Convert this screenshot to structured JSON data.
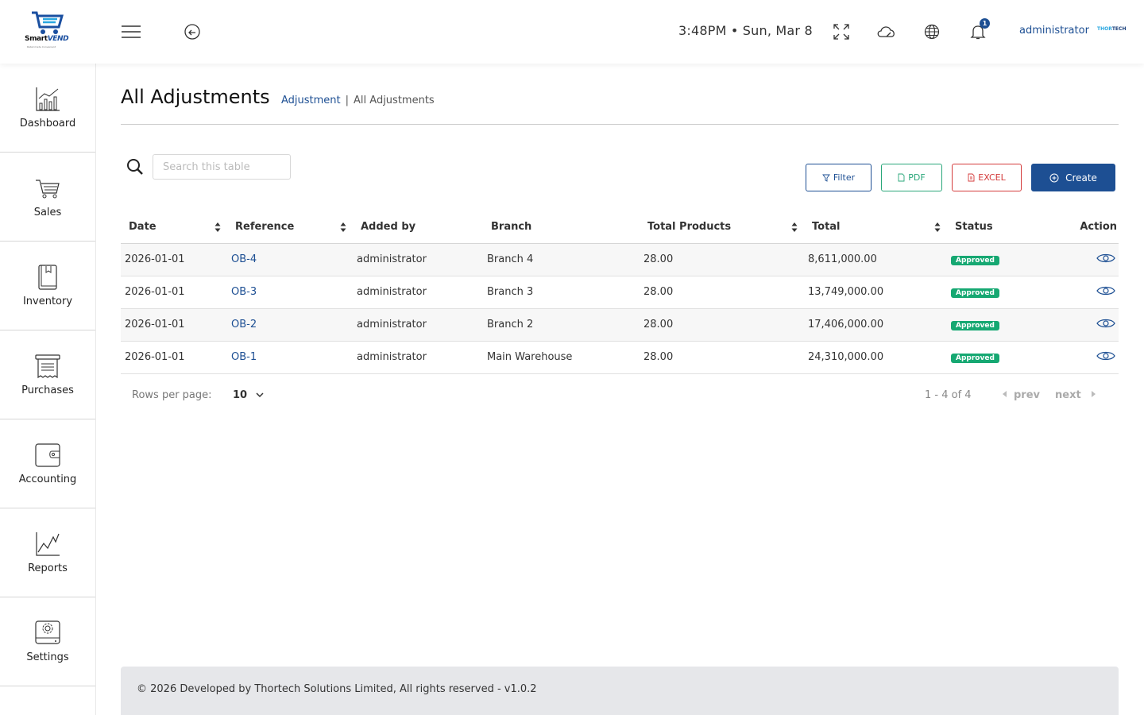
{
  "app": {
    "brand_primary": "Smart",
    "brand_secondary": "VEND",
    "brand_tagline": "Retail made Convenient",
    "accent_color": "#1d4f93"
  },
  "header": {
    "clock": "3:48PM • Sun, Mar 8",
    "notification_count": "1",
    "user_name": "administrator",
    "user_logo_a": "THOR",
    "user_logo_b": "TECH"
  },
  "sidebar": {
    "items": [
      {
        "label": "Dashboard",
        "icon": "bar-chart-icon"
      },
      {
        "label": "Sales",
        "icon": "cart-icon"
      },
      {
        "label": "Inventory",
        "icon": "book-icon"
      },
      {
        "label": "Purchases",
        "icon": "receipt-icon"
      },
      {
        "label": "Accounting",
        "icon": "wallet-icon"
      },
      {
        "label": "Reports",
        "icon": "line-chart-icon"
      },
      {
        "label": "Settings",
        "icon": "gear-icon"
      }
    ]
  },
  "page": {
    "title": "All Adjustments",
    "breadcrumb_parent": "Adjustment",
    "breadcrumb_current": "All Adjustments"
  },
  "toolbar": {
    "search_placeholder": "Search this table",
    "filter_label": "Filter",
    "pdf_label": "PDF",
    "excel_label": "EXCEL",
    "create_label": "Create"
  },
  "table": {
    "columns": [
      "Date",
      "Reference",
      "Added by",
      "Branch",
      "Total Products",
      "Total",
      "Status",
      "Action"
    ],
    "rows": [
      {
        "date": "2026-01-01",
        "reference": "OB-4",
        "added_by": "administrator",
        "branch": "Branch 4",
        "total_products": "28.00",
        "total": "8,611,000.00",
        "status": "Approved"
      },
      {
        "date": "2026-01-01",
        "reference": "OB-3",
        "added_by": "administrator",
        "branch": "Branch 3",
        "total_products": "28.00",
        "total": "13,749,000.00",
        "status": "Approved"
      },
      {
        "date": "2026-01-01",
        "reference": "OB-2",
        "added_by": "administrator",
        "branch": "Branch 2",
        "total_products": "28.00",
        "total": "17,406,000.00",
        "status": "Approved"
      },
      {
        "date": "2026-01-01",
        "reference": "OB-1",
        "added_by": "administrator",
        "branch": "Main Warehouse",
        "total_products": "28.00",
        "total": "24,310,000.00",
        "status": "Approved"
      }
    ]
  },
  "pagination": {
    "rows_per_page_label": "Rows per page:",
    "rows_per_page_value": "10",
    "range": "1 - 4 of 4",
    "prev_label": "prev",
    "next_label": "next"
  },
  "footer": {
    "text": "© 2026 Developed by Thortech Solutions Limited, All rights reserved - v1.0.2"
  }
}
